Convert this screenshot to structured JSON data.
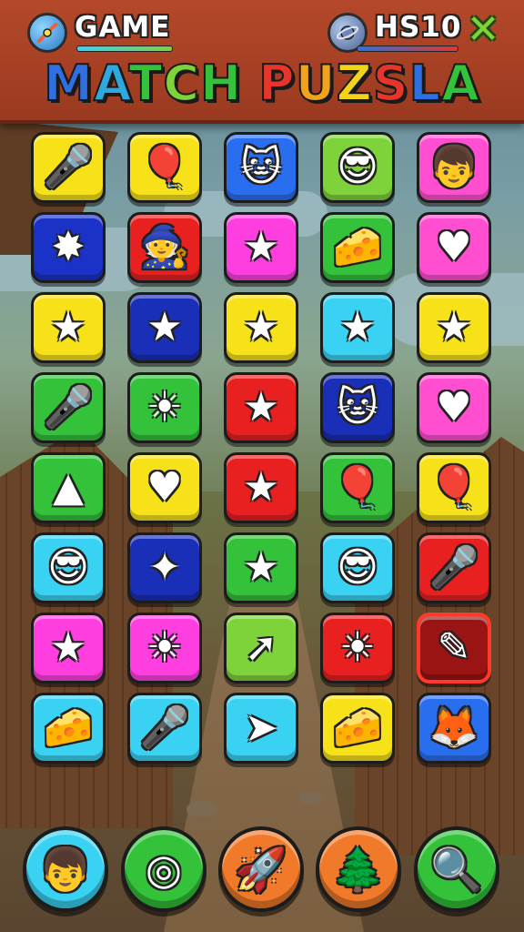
{
  "header": {
    "left_label": "GAME",
    "right_label": "HS10",
    "close_icon": "close-x-icon",
    "left_icon": "sparkle-orb-icon",
    "right_icon": "planet-orb-icon",
    "title_words": [
      {
        "text": "M",
        "color": "#2f6fe0"
      },
      {
        "text": "A",
        "color": "#2fa8e0"
      },
      {
        "text": "T",
        "color": "#33c23a"
      },
      {
        "text": "C",
        "color": "#7ed23a"
      },
      {
        "text": "H",
        "color": "#33c23a"
      },
      {
        "text": " ",
        "color": "#ffffff"
      },
      {
        "text": "P",
        "color": "#e8342a"
      },
      {
        "text": "U",
        "color": "#f2a21c"
      },
      {
        "text": "Z",
        "color": "#f2d41c"
      },
      {
        "text": "S",
        "color": "#e8342a"
      },
      {
        "text": "L",
        "color": "#2f6fe0"
      },
      {
        "text": "A",
        "color": "#33c23a"
      }
    ]
  },
  "grid": {
    "columns": 5,
    "rows": [
      [
        {
          "icon": "microphone-icon",
          "glyph": "🎤",
          "color": "#f7e21a"
        },
        {
          "icon": "green-balloon-icon",
          "glyph": "🎈",
          "color": "#f7e21a"
        },
        {
          "icon": "cat-face-icon",
          "glyph": "🐱",
          "color": "#2a6ef0"
        },
        {
          "icon": "alien-sunglasses-icon",
          "glyph": "😎",
          "color": "#7ed23a"
        },
        {
          "icon": "boy-face-icon",
          "glyph": "👦",
          "color": "#ff4fd0"
        }
      ],
      [
        {
          "icon": "pink-star-burst-icon",
          "glyph": "✸",
          "color": "#1a32c8"
        },
        {
          "icon": "wizard-sunglasses-icon",
          "glyph": "🧙",
          "color": "#e82020"
        },
        {
          "icon": "white-star-icon",
          "glyph": "★",
          "color": "#ff3ee0"
        },
        {
          "icon": "cheese-icon",
          "glyph": "🧀",
          "color": "#33c23a"
        },
        {
          "icon": "heart-icon",
          "glyph": "♥",
          "color": "#ff4fd0"
        }
      ],
      [
        {
          "icon": "yellow-star-icon",
          "glyph": "★",
          "color": "#f7e21a"
        },
        {
          "icon": "yellow-star-icon",
          "glyph": "★",
          "color": "#1a2fb8"
        },
        {
          "icon": "yellow-star-icon",
          "glyph": "★",
          "color": "#f7e21a"
        },
        {
          "icon": "white-star-icon",
          "glyph": "★",
          "color": "#3ad2f2"
        },
        {
          "icon": "green-star-icon",
          "glyph": "★",
          "color": "#f7e21a"
        }
      ],
      [
        {
          "icon": "microphone-icon",
          "glyph": "🎤",
          "color": "#33c23a"
        },
        {
          "icon": "sun-face-icon",
          "glyph": "☀",
          "color": "#33c23a"
        },
        {
          "icon": "yellow-star-icon",
          "glyph": "★",
          "color": "#e82020"
        },
        {
          "icon": "cat-face-icon",
          "glyph": "🐱",
          "color": "#1a2fb8"
        },
        {
          "icon": "blue-heart-icon",
          "glyph": "♥",
          "color": "#ff4fd0"
        }
      ],
      [
        {
          "icon": "purple-tree-icon",
          "glyph": "▲",
          "color": "#33c23a"
        },
        {
          "icon": "heart-icon",
          "glyph": "♥",
          "color": "#f7e21a"
        },
        {
          "icon": "yellow-star-icon",
          "glyph": "★",
          "color": "#e82020"
        },
        {
          "icon": "red-balloon-icon",
          "glyph": "🎈",
          "color": "#33c23a"
        },
        {
          "icon": "green-balloon-icon",
          "glyph": "🎈",
          "color": "#f7e21a"
        }
      ],
      [
        {
          "icon": "wizard-sunglasses-icon",
          "glyph": "😎",
          "color": "#3ad2f2"
        },
        {
          "icon": "silver-star-icon",
          "glyph": "✦",
          "color": "#1a2fb8"
        },
        {
          "icon": "yellow-star-icon",
          "glyph": "★",
          "color": "#33c23a"
        },
        {
          "icon": "alien-sunglasses-icon",
          "glyph": "😎",
          "color": "#3ad2f2"
        },
        {
          "icon": "microphone-icon",
          "glyph": "🎤",
          "color": "#e82020"
        }
      ],
      [
        {
          "icon": "blue-star-icon",
          "glyph": "★",
          "color": "#ff3ee0"
        },
        {
          "icon": "sun-face-icon",
          "glyph": "☀",
          "color": "#ff3ee0"
        },
        {
          "icon": "green-arrow-icon",
          "glyph": "➚",
          "color": "#7ed23a"
        },
        {
          "icon": "green-sun-face-icon",
          "glyph": "☀",
          "color": "#e82020"
        },
        {
          "icon": "paint-tube-icon",
          "glyph": "✎",
          "color": "#9a1414",
          "selected": true
        }
      ],
      [
        {
          "icon": "cheese-icon",
          "glyph": "🧀",
          "color": "#3ad2f2"
        },
        {
          "icon": "microphone-icon",
          "glyph": "🎤",
          "color": "#3ad2f2"
        },
        {
          "icon": "pointer-cursor-icon",
          "glyph": "➤",
          "color": "#3ad2f2"
        },
        {
          "icon": "cheese-icon",
          "glyph": "🧀",
          "color": "#f7e21a"
        },
        {
          "icon": "fox-face-icon",
          "glyph": "🦊",
          "color": "#2a6ef0"
        }
      ]
    ]
  },
  "powerups": [
    {
      "icon": "boy-face-icon",
      "glyph": "👦",
      "color": "#3ad2f2"
    },
    {
      "icon": "target-icon",
      "glyph": "◎",
      "color": "#33c23a"
    },
    {
      "icon": "rocket-brush-icon",
      "glyph": "🚀",
      "color": "#f07a2a"
    },
    {
      "icon": "pine-tree-icon",
      "glyph": "🌲",
      "color": "#f07a2a"
    },
    {
      "icon": "magnifier-icon",
      "glyph": "🔍",
      "color": "#33c23a"
    }
  ]
}
